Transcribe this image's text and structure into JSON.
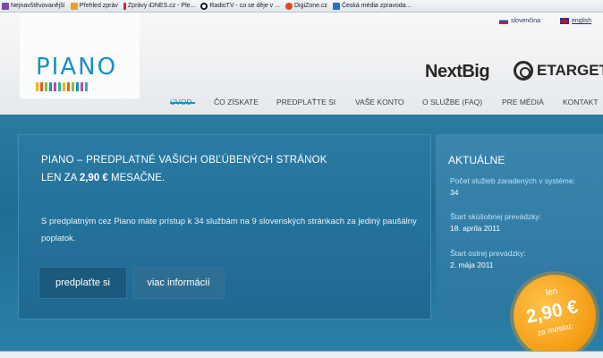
{
  "bookmarks": [
    {
      "label": "Nejnavštěvovanější",
      "color": "#7b4aa0"
    },
    {
      "label": "Přehled zpráv",
      "color": "#e6a22a"
    },
    {
      "label": "Zprávy iDNES.cz - Ple...",
      "color": "#d8232a"
    },
    {
      "label": "RadioTV - co se děje v ...",
      "color": "#1a1a1a"
    },
    {
      "label": "DigiZone.cz",
      "color": "#e04a1a"
    },
    {
      "label": "Česká média zpravoda...",
      "color": "#2c6fbf"
    }
  ],
  "header": {
    "logo": "PIANO",
    "logo_colors": [
      "#f2b51c",
      "#e85d24",
      "#8bbf3a",
      "#1b8fc4",
      "#b44e9e",
      "#2bb3a6",
      "#f2b51c",
      "#e85d24",
      "#8bbf3a",
      "#1b8fc4",
      "#b44e9e",
      "#2bb3a6"
    ],
    "lang_sk": "slovenčina",
    "lang_en": "english",
    "partner1": "NextBig",
    "partner2": "ETARGET"
  },
  "nav": {
    "items": [
      "ÚVOD",
      "ČO ZÍSKATE",
      "PREDPLAŤTE SI",
      "VAŠE KONTO",
      "O SLUŽBE (FAQ)",
      "PRE MÉDIÁ",
      "KONTAKT"
    ],
    "active": "ÚVOD"
  },
  "main": {
    "title": "PIANO – PREDPLATNÉ VAŠICH OBĽÚBENÝCH STRÁNOK",
    "price_prefix": "LEN ZA",
    "price_value": "2,90 €",
    "price_suffix": "MESAČNE.",
    "description": "S predplatným cez Piano máte prístup k 34 službám na 9 slovenských stránkach za jediný paušálny poplatok.",
    "button_subscribe": "predplaťte si",
    "button_more": "viac informácií"
  },
  "side": {
    "title": "AKTUÁLNE",
    "services_label": "Počet služieb zaradených v systéme:",
    "services_value": "34",
    "trial_label": "Štart skúšobnej prevádzky:",
    "trial_value": "18. apríla 2011",
    "live_label": "Štart ostrej prevádzky:",
    "live_value": "2. mája 2011"
  },
  "badge": {
    "top": "len",
    "price": "2,90 €",
    "bottom": "za mesiac"
  }
}
